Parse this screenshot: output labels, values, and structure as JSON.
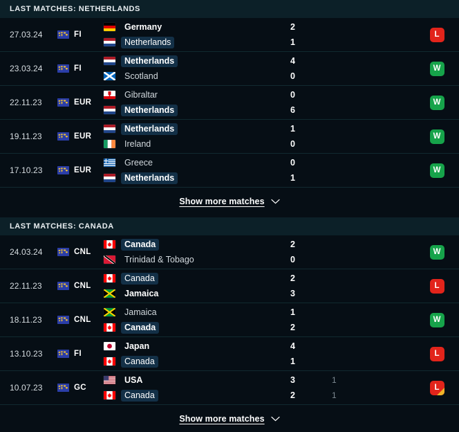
{
  "sections": [
    {
      "header": "LAST MATCHES: NETHERLANDS",
      "highlight_team": "Netherlands",
      "show_more_label": "Show more matches",
      "matches": [
        {
          "date": "27.03.24",
          "competition_icon": "world-globe-icon",
          "competition": "FI",
          "home": {
            "team": "Germany",
            "flag": "de",
            "score": "2",
            "pen": "",
            "winner": true,
            "highlight": false
          },
          "away": {
            "team": "Netherlands",
            "flag": "nl",
            "score": "1",
            "pen": "",
            "winner": false,
            "highlight": true
          },
          "result": "L",
          "result_type": "loss",
          "result_corner": false
        },
        {
          "date": "23.03.24",
          "competition_icon": "world-globe-icon",
          "competition": "FI",
          "home": {
            "team": "Netherlands",
            "flag": "nl",
            "score": "4",
            "pen": "",
            "winner": true,
            "highlight": true
          },
          "away": {
            "team": "Scotland",
            "flag": "sc",
            "score": "0",
            "pen": "",
            "winner": false,
            "highlight": false
          },
          "result": "W",
          "result_type": "win",
          "result_corner": false
        },
        {
          "date": "22.11.23",
          "competition_icon": "world-globe-icon",
          "competition": "EUR",
          "home": {
            "team": "Gibraltar",
            "flag": "gi",
            "score": "0",
            "pen": "",
            "winner": false,
            "highlight": false
          },
          "away": {
            "team": "Netherlands",
            "flag": "nl",
            "score": "6",
            "pen": "",
            "winner": true,
            "highlight": true
          },
          "result": "W",
          "result_type": "win",
          "result_corner": false
        },
        {
          "date": "19.11.23",
          "competition_icon": "world-globe-icon",
          "competition": "EUR",
          "home": {
            "team": "Netherlands",
            "flag": "nl",
            "score": "1",
            "pen": "",
            "winner": true,
            "highlight": true
          },
          "away": {
            "team": "Ireland",
            "flag": "ie",
            "score": "0",
            "pen": "",
            "winner": false,
            "highlight": false
          },
          "result": "W",
          "result_type": "win",
          "result_corner": false
        },
        {
          "date": "17.10.23",
          "competition_icon": "world-globe-icon",
          "competition": "EUR",
          "home": {
            "team": "Greece",
            "flag": "gr",
            "score": "0",
            "pen": "",
            "winner": false,
            "highlight": false
          },
          "away": {
            "team": "Netherlands",
            "flag": "nl",
            "score": "1",
            "pen": "",
            "winner": true,
            "highlight": true
          },
          "result": "W",
          "result_type": "win",
          "result_corner": false
        }
      ]
    },
    {
      "header": "LAST MATCHES: CANADA",
      "highlight_team": "Canada",
      "show_more_label": "Show more matches",
      "matches": [
        {
          "date": "24.03.24",
          "competition_icon": "world-globe-icon",
          "competition": "CNL",
          "home": {
            "team": "Canada",
            "flag": "ca",
            "score": "2",
            "pen": "",
            "winner": true,
            "highlight": true
          },
          "away": {
            "team": "Trinidad & Tobago",
            "flag": "tt",
            "score": "0",
            "pen": "",
            "winner": false,
            "highlight": false
          },
          "result": "W",
          "result_type": "win",
          "result_corner": false
        },
        {
          "date": "22.11.23",
          "competition_icon": "world-globe-icon",
          "competition": "CNL",
          "home": {
            "team": "Canada",
            "flag": "ca",
            "score": "2",
            "pen": "",
            "winner": false,
            "highlight": true
          },
          "away": {
            "team": "Jamaica",
            "flag": "jm",
            "score": "3",
            "pen": "",
            "winner": true,
            "highlight": false
          },
          "result": "L",
          "result_type": "loss",
          "result_corner": false
        },
        {
          "date": "18.11.23",
          "competition_icon": "world-globe-icon",
          "competition": "CNL",
          "home": {
            "team": "Jamaica",
            "flag": "jm",
            "score": "1",
            "pen": "",
            "winner": false,
            "highlight": false
          },
          "away": {
            "team": "Canada",
            "flag": "ca",
            "score": "2",
            "pen": "",
            "winner": true,
            "highlight": true
          },
          "result": "W",
          "result_type": "win",
          "result_corner": false
        },
        {
          "date": "13.10.23",
          "competition_icon": "world-globe-icon",
          "competition": "FI",
          "home": {
            "team": "Japan",
            "flag": "jp",
            "score": "4",
            "pen": "",
            "winner": true,
            "highlight": false
          },
          "away": {
            "team": "Canada",
            "flag": "ca",
            "score": "1",
            "pen": "",
            "winner": false,
            "highlight": true
          },
          "result": "L",
          "result_type": "loss",
          "result_corner": false
        },
        {
          "date": "10.07.23",
          "competition_icon": "world-globe-icon",
          "competition": "GC",
          "home": {
            "team": "USA",
            "flag": "us",
            "score": "3",
            "pen": "1",
            "winner": true,
            "highlight": false
          },
          "away": {
            "team": "Canada",
            "flag": "ca",
            "score": "2",
            "pen": "1",
            "winner": false,
            "highlight": true
          },
          "result": "L",
          "result_type": "loss",
          "result_corner": true
        }
      ]
    }
  ],
  "colors": {
    "background": "#060e15",
    "section_header_bg": "#0c2028",
    "row_divider": "#112a30",
    "highlight_bg": "#133047",
    "win_badge": "#16a34a",
    "loss_badge": "#e2241b",
    "corner_accent": "#f0b429",
    "competition_icon_bg": "#2b3ea8"
  }
}
